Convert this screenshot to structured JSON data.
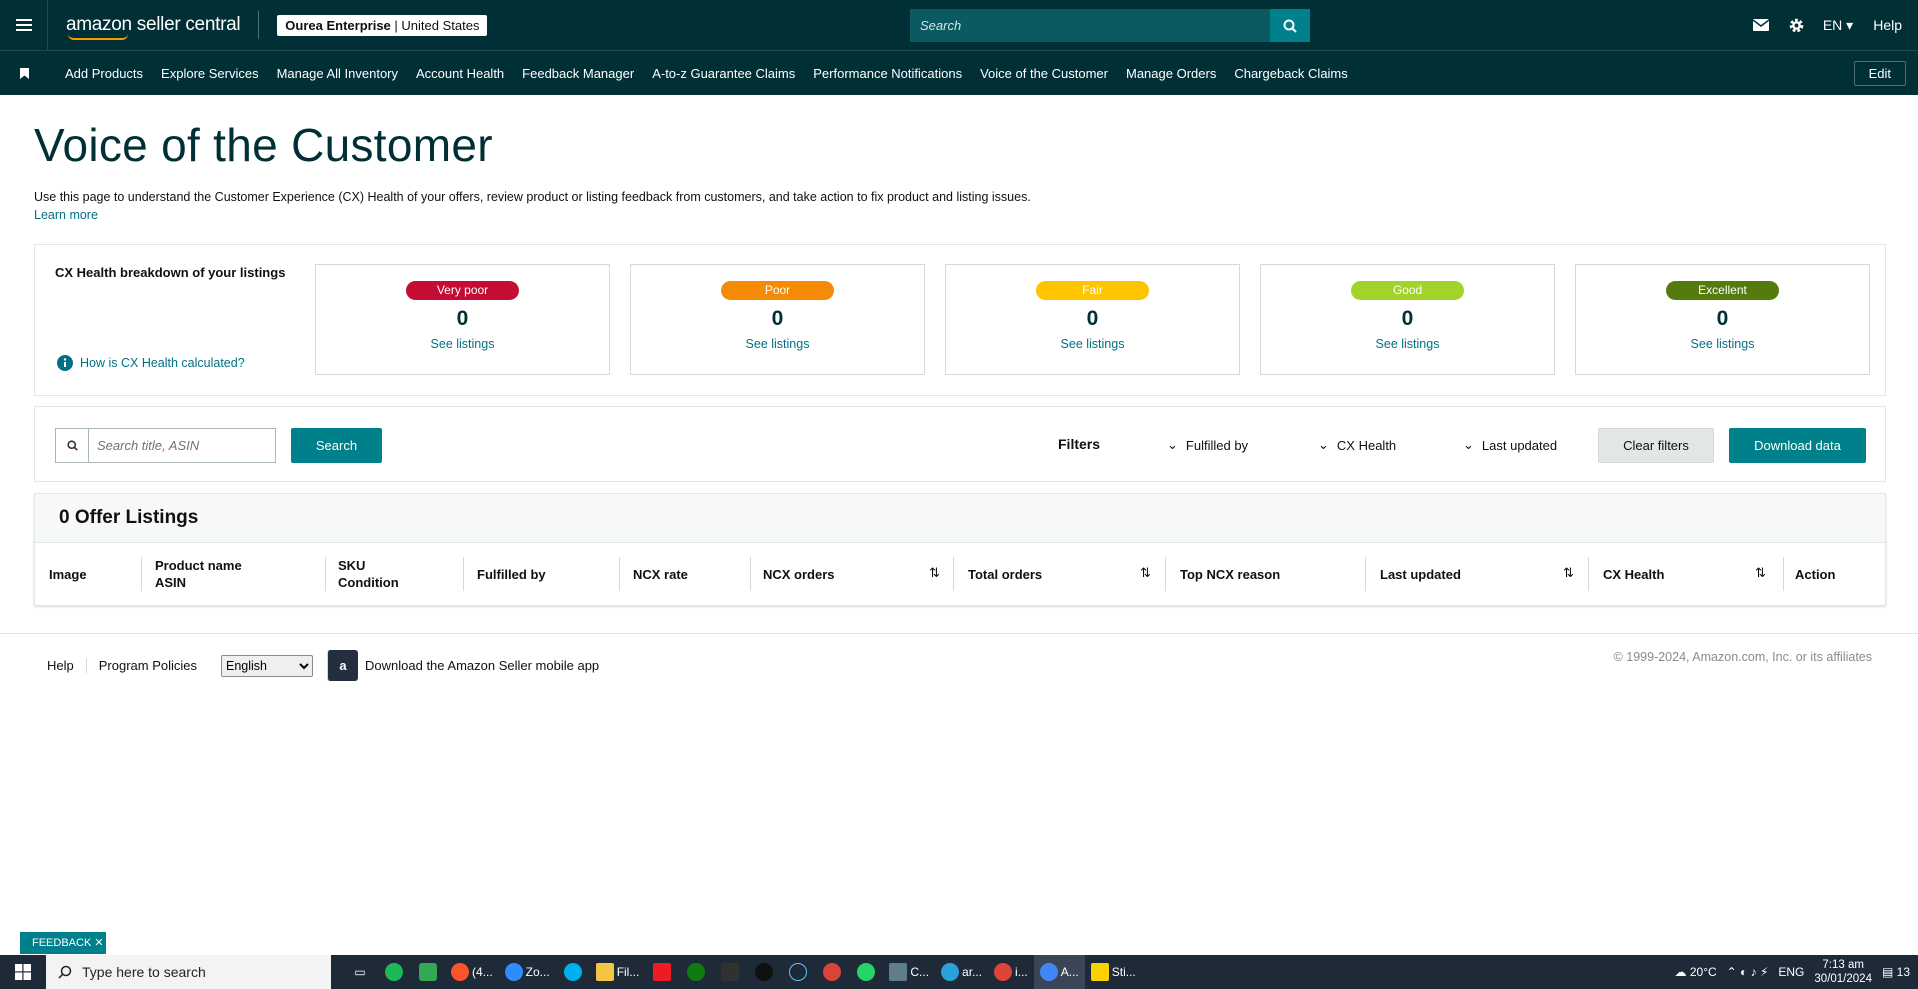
{
  "topbar": {
    "logo": "amazon seller central",
    "account_name": "Ourea Enterprise",
    "account_region": "United States",
    "search_placeholder": "Search",
    "language": "EN",
    "help": "Help"
  },
  "nav": {
    "links": [
      "Add Products",
      "Explore Services",
      "Manage All Inventory",
      "Account Health",
      "Feedback Manager",
      "A-to-z Guarantee Claims",
      "Performance Notifications",
      "Voice of the Customer",
      "Manage Orders",
      "Chargeback Claims"
    ],
    "edit": "Edit"
  },
  "page": {
    "title": "Voice of the Customer",
    "description": "Use this page to understand the Customer Experience (CX) Health of your offers, review product or listing feedback from customers, and take action to fix product and listing issues.",
    "learn_more": "Learn more"
  },
  "cx_health": {
    "heading": "CX Health breakdown of your listings",
    "how_link": "How is CX Health calculated?",
    "cards": [
      {
        "label": "Very poor",
        "count": "0",
        "link": "See listings",
        "color": "#c40c35"
      },
      {
        "label": "Poor",
        "count": "0",
        "link": "See listings",
        "color": "#f58a07"
      },
      {
        "label": "Fair",
        "count": "0",
        "link": "See listings",
        "color": "#ffc400"
      },
      {
        "label": "Good",
        "count": "0",
        "link": "See listings",
        "color": "#a3d22b"
      },
      {
        "label": "Excellent",
        "count": "0",
        "link": "See listings",
        "color": "#557a0d"
      }
    ]
  },
  "filters": {
    "search_placeholder": "Search title, ASIN",
    "search_button": "Search",
    "label": "Filters",
    "fulfilled_by": "Fulfilled by",
    "cx_health": "CX Health",
    "last_updated": "Last updated",
    "clear": "Clear filters",
    "download": "Download data"
  },
  "table": {
    "heading": "0 Offer Listings",
    "columns": {
      "image": "Image",
      "product_name": "Product name",
      "asin": "ASIN",
      "sku": "SKU",
      "condition": "Condition",
      "fulfilled_by": "Fulfilled by",
      "ncx_rate": "NCX rate",
      "ncx_orders": "NCX orders",
      "total_orders": "Total orders",
      "top_ncx_reason": "Top NCX reason",
      "last_updated": "Last updated",
      "cx_health": "CX Health",
      "action": "Action"
    }
  },
  "footer": {
    "help": "Help",
    "program_policies": "Program Policies",
    "language": "English",
    "app_text": "Download the Amazon Seller mobile app",
    "copyright": "© 1999-2024, Amazon.com, Inc. or its affiliates"
  },
  "feedback_tab": "FEEDBACK",
  "taskbar": {
    "search_placeholder": "Type here to search",
    "apps": [
      {
        "label": "(4...",
        "color": "#fb542b"
      },
      {
        "label": "Zo...",
        "color": "#2d8cff"
      },
      {
        "label": "Fil...",
        "color": "#f4c542"
      },
      {
        "label": "C...",
        "color": "#607d8b"
      },
      {
        "label": "ar...",
        "color": "#2aa1da"
      },
      {
        "label": "i...",
        "color": "#db4437"
      },
      {
        "label": "A...",
        "color": "#4285f4"
      },
      {
        "label": "Sti...",
        "color": "#f7d100"
      }
    ],
    "weather": "20°C",
    "language": "ENG",
    "time": "7:13 am",
    "date": "30/01/2024",
    "notifications": "13"
  }
}
